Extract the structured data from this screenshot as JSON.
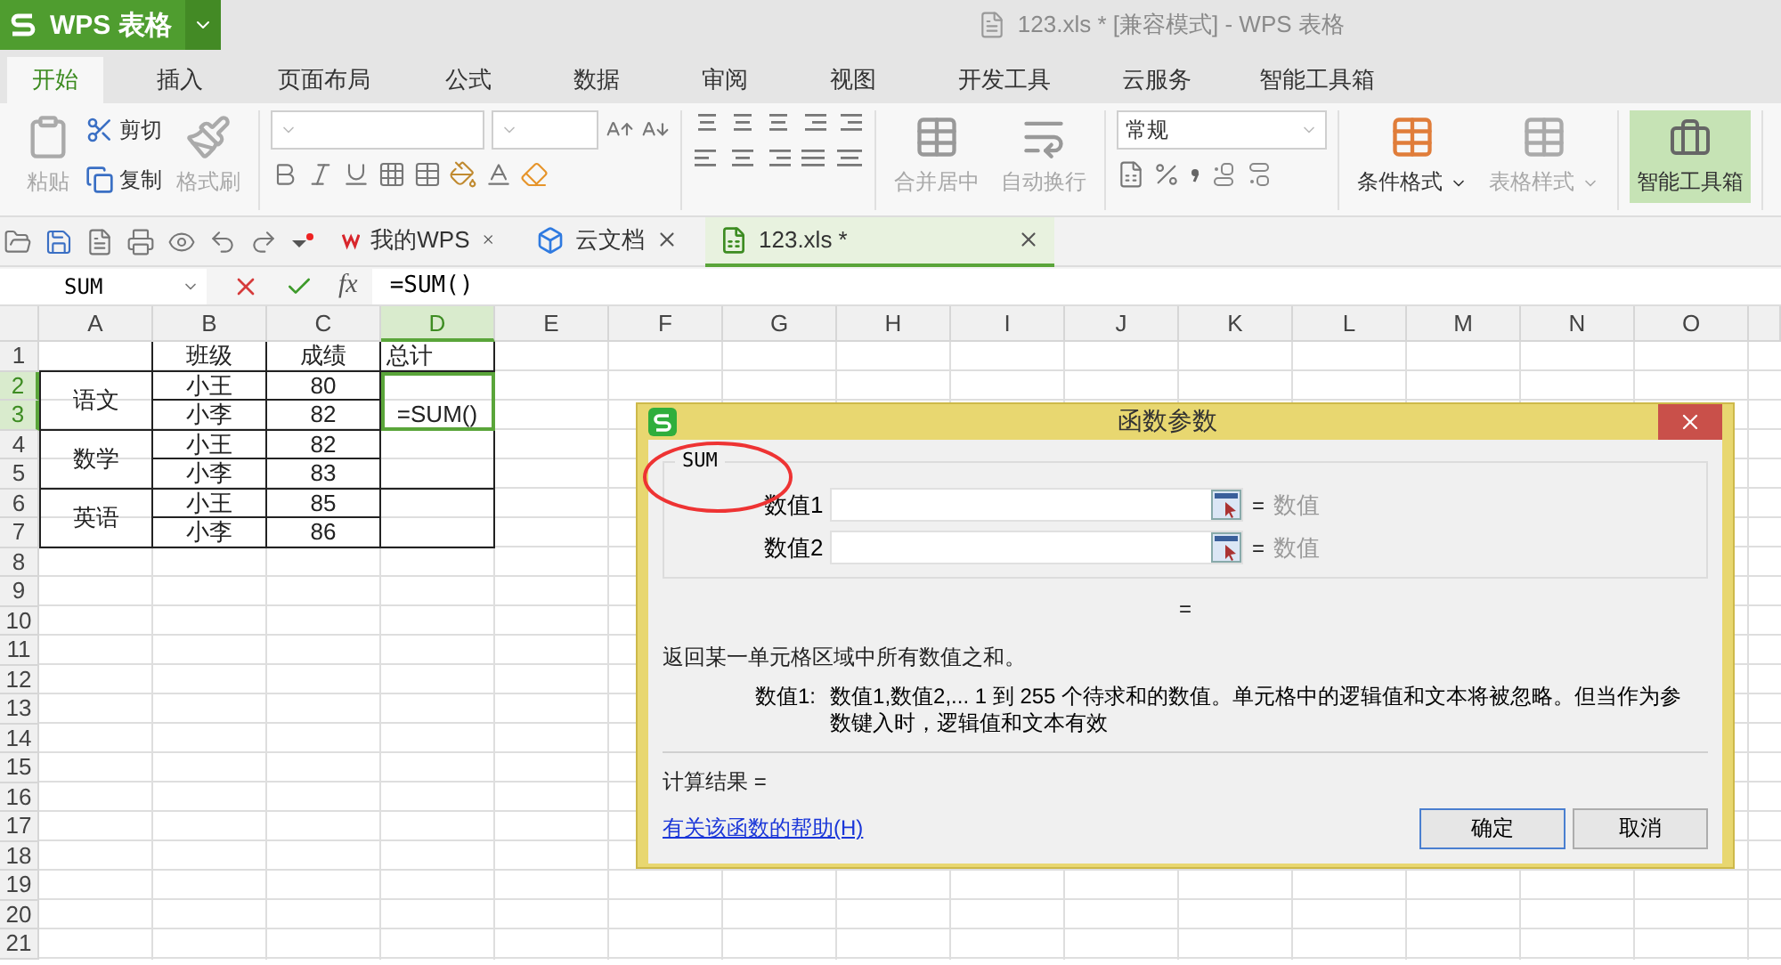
{
  "app": {
    "name": "WPS 表格"
  },
  "window": {
    "title": "123.xls * [兼容模式] - WPS 表格"
  },
  "menu_tabs": [
    {
      "label": "开始",
      "selected": true
    },
    {
      "label": "插入",
      "selected": false
    },
    {
      "label": "页面布局",
      "selected": false
    },
    {
      "label": "公式",
      "selected": false
    },
    {
      "label": "数据",
      "selected": false
    },
    {
      "label": "审阅",
      "selected": false
    },
    {
      "label": "视图",
      "selected": false
    },
    {
      "label": "开发工具",
      "selected": false
    },
    {
      "label": "云服务",
      "selected": false
    },
    {
      "label": "智能工具箱",
      "selected": false
    }
  ],
  "ribbon": {
    "clipboard": [
      {
        "label": "粘贴",
        "disabled": true
      },
      {
        "label": "剪切",
        "disabled": false
      },
      {
        "label": "复制",
        "disabled": false
      },
      {
        "label": "格式刷",
        "disabled": true
      }
    ],
    "alignment": [
      {
        "label": "合并居中",
        "disabled": true
      },
      {
        "label": "自动换行",
        "disabled": true
      }
    ],
    "number_format": {
      "value": "常规"
    },
    "styles": [
      {
        "label": "条件格式",
        "disabled": false
      },
      {
        "label": "表格样式",
        "disabled": true
      }
    ],
    "toolbox": {
      "label": "智能工具箱",
      "selected": true
    }
  },
  "doc_tabs": [
    {
      "label": "我的WPS",
      "selected": false
    },
    {
      "label": "云文档",
      "selected": false
    },
    {
      "label": "123.xls *",
      "selected": true
    }
  ],
  "formula_bar": {
    "name_box": "SUM",
    "fx_label": "fx",
    "formula": "=SUM()"
  },
  "sheet": {
    "columns": [
      {
        "label": "A",
        "selected": false
      },
      {
        "label": "B",
        "selected": false
      },
      {
        "label": "C",
        "selected": false
      },
      {
        "label": "D",
        "selected": true
      },
      {
        "label": "E",
        "selected": false
      },
      {
        "label": "F",
        "selected": false
      },
      {
        "label": "G",
        "selected": false
      },
      {
        "label": "H",
        "selected": false
      },
      {
        "label": "I",
        "selected": false
      },
      {
        "label": "J",
        "selected": false
      },
      {
        "label": "K",
        "selected": false
      },
      {
        "label": "L",
        "selected": false
      },
      {
        "label": "M",
        "selected": false
      },
      {
        "label": "N",
        "selected": false
      },
      {
        "label": "O",
        "selected": false
      }
    ],
    "rows": [
      {
        "label": "1",
        "selected": false
      },
      {
        "label": "2",
        "selected": true
      },
      {
        "label": "3",
        "selected": true
      },
      {
        "label": "4",
        "selected": false
      },
      {
        "label": "5",
        "selected": false
      },
      {
        "label": "6",
        "selected": false
      },
      {
        "label": "7",
        "selected": false
      },
      {
        "label": "8",
        "selected": false
      },
      {
        "label": "9",
        "selected": false
      },
      {
        "label": "10",
        "selected": false
      },
      {
        "label": "11",
        "selected": false
      },
      {
        "label": "12",
        "selected": false
      },
      {
        "label": "13",
        "selected": false
      },
      {
        "label": "14",
        "selected": false
      },
      {
        "label": "15",
        "selected": false
      },
      {
        "label": "16",
        "selected": false
      },
      {
        "label": "17",
        "selected": false
      },
      {
        "label": "18",
        "selected": false
      },
      {
        "label": "19",
        "selected": false
      },
      {
        "label": "20",
        "selected": false
      },
      {
        "label": "21",
        "selected": false
      }
    ],
    "headers": [
      "班级",
      "成绩",
      "总计"
    ],
    "groups": [
      {
        "subject": "语文",
        "total": "=SUM()",
        "selected": true,
        "entries": [
          {
            "name": "小王",
            "score": "80"
          },
          {
            "name": "小李",
            "score": "82"
          }
        ]
      },
      {
        "subject": "数学",
        "selected": false,
        "entries": [
          {
            "name": "小王",
            "score": "82"
          },
          {
            "name": "小李",
            "score": "83"
          }
        ]
      },
      {
        "subject": "英语",
        "selected": false,
        "entries": [
          {
            "name": "小王",
            "score": "85"
          },
          {
            "name": "小李",
            "score": "86"
          }
        ]
      }
    ]
  },
  "dialog": {
    "title": "函数参数",
    "function_name": "SUM",
    "arguments": [
      {
        "label": "数值1",
        "sign": "=",
        "result": "数值"
      },
      {
        "label": "数值2",
        "sign": "=",
        "result": "数值"
      }
    ],
    "formula_result": "=",
    "description": "返回某一单元格区域中所有数值之和。",
    "argument_help": {
      "label": "数值1:",
      "text": "数值1,数值2,... 1 到 255 个待求和的数值。单元格中的逻辑值和文本将被忽略。但当作为参数键入时，逻辑值和文本有效"
    },
    "result_label": "计算结果 =",
    "help_link": "有关该函数的帮助(H)",
    "buttons": [
      "确定",
      "取消"
    ]
  }
}
